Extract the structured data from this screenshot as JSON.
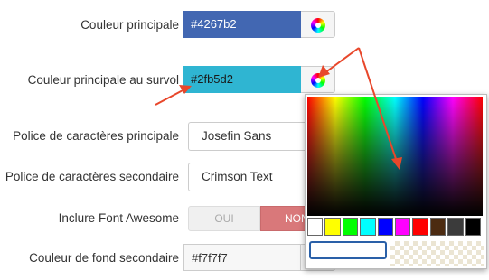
{
  "fields": {
    "primary_color": {
      "label": "Couleur principale",
      "value": "#4267b2",
      "bg": "#4267b2",
      "fg": "#ffffff"
    },
    "hover_color": {
      "label": "Couleur principale au survol",
      "value": "#2fb5d2",
      "bg": "#2fb5d2",
      "fg": "#1a1a1a"
    },
    "main_font": {
      "label": "Police de caractères principale",
      "value": "Josefin Sans"
    },
    "secondary_font": {
      "label": "Police de caractères secondaire",
      "value": "Crimson Text"
    },
    "font_awesome": {
      "label": "Inclure Font Awesome",
      "option_yes": "OUI",
      "option_no": "NON",
      "selected": "NON"
    },
    "secondary_bg": {
      "label": "Couleur de fond secondaire",
      "value": "#f7f7f7",
      "bg": "#f7f7f7",
      "fg": "#333333"
    }
  },
  "picker": {
    "palette": [
      "#ffffff",
      "#ffff00",
      "#00ff00",
      "#00ffff",
      "#0000ff",
      "#ff00ff",
      "#ff0000",
      "#4c2b11",
      "#3b3b3b",
      "#000000"
    ],
    "hex_value": ""
  },
  "annotation_color": "#e8472b",
  "icons": [
    "color-wheel-icon"
  ]
}
